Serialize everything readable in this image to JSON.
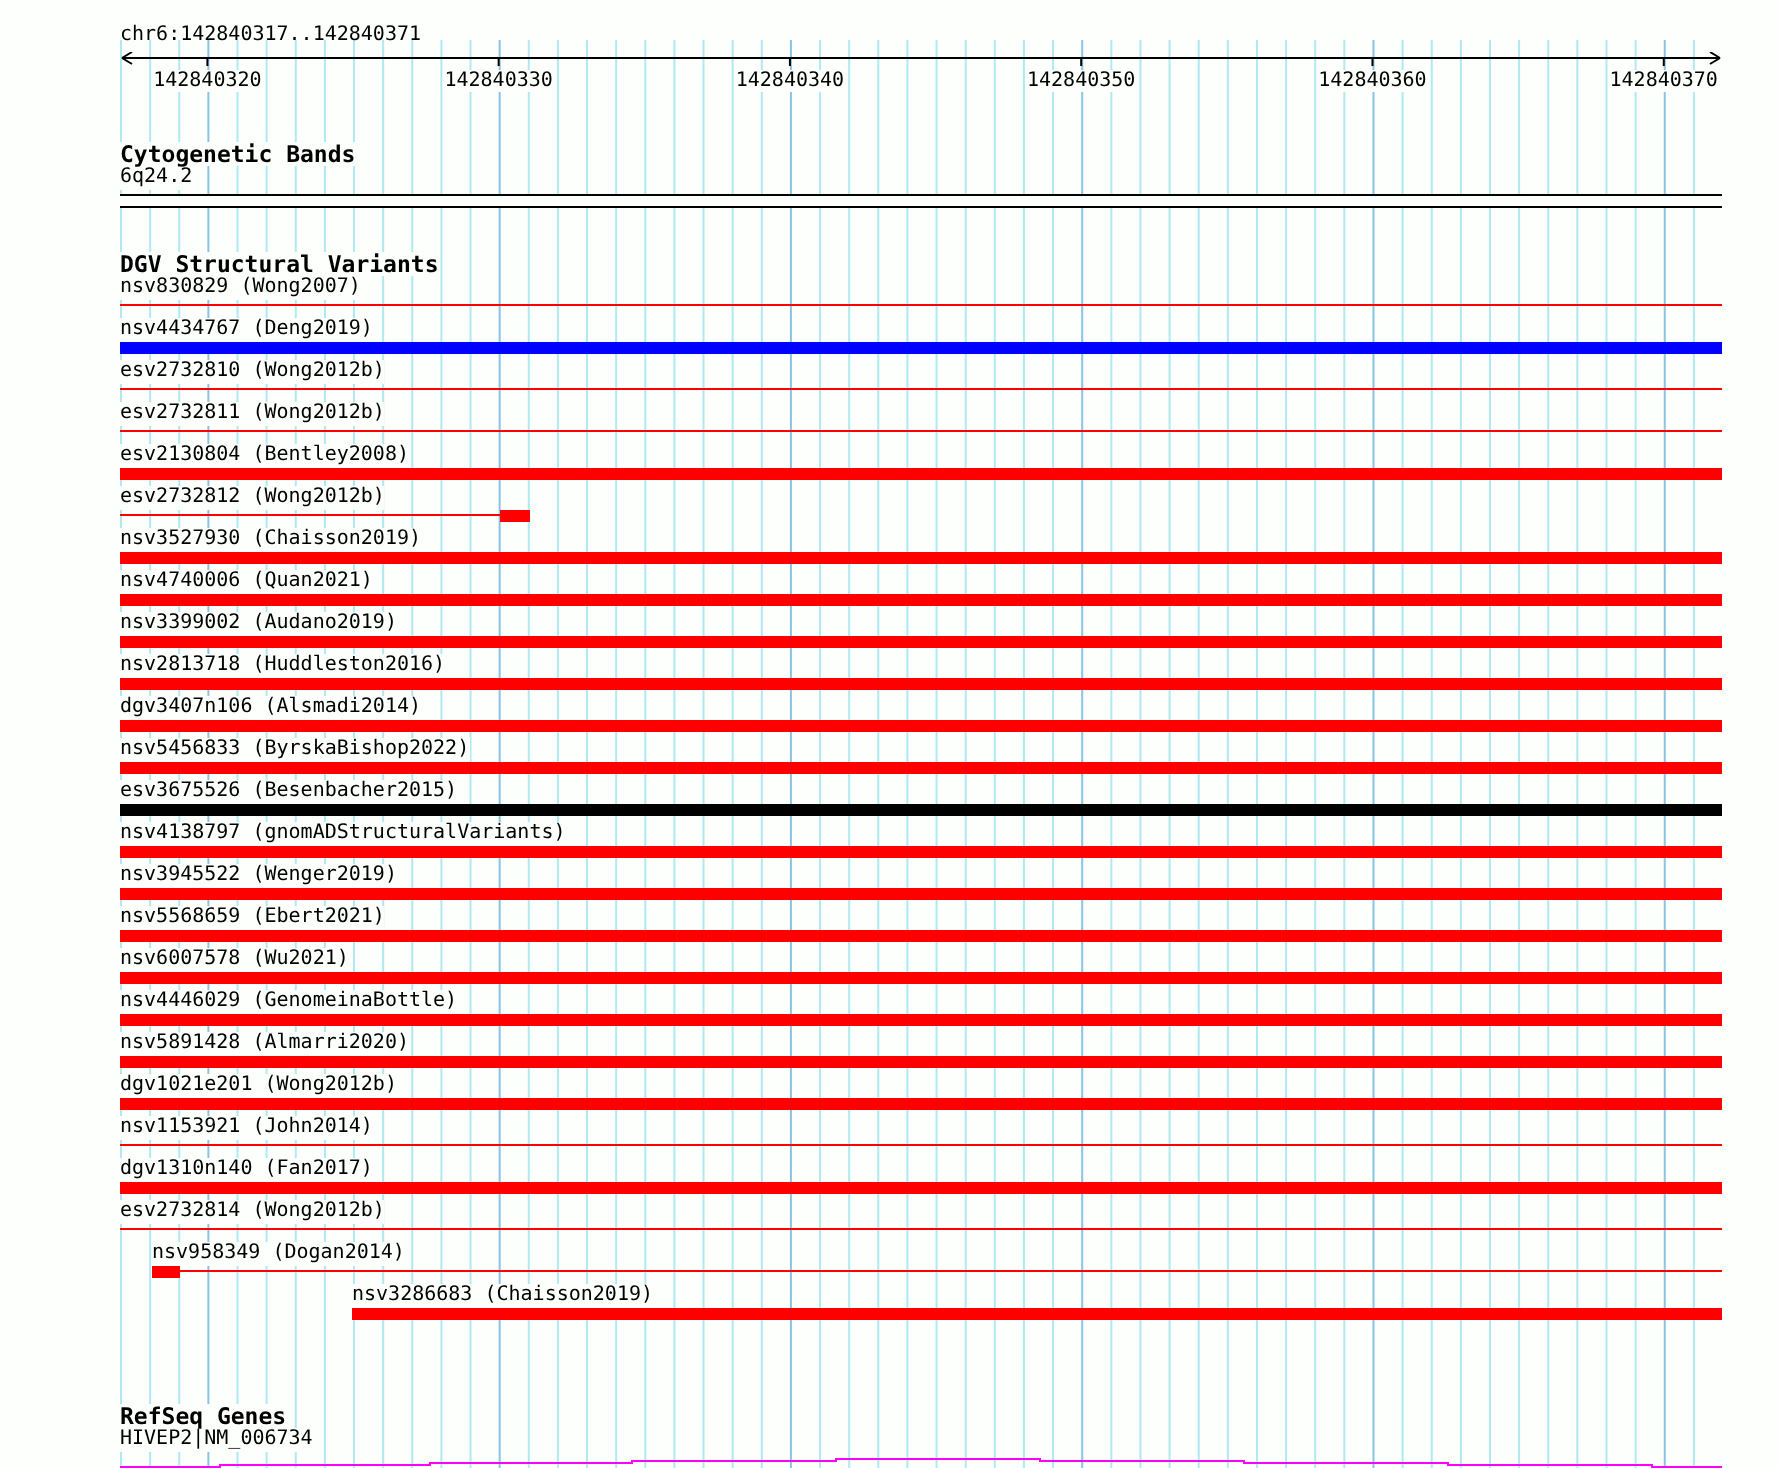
{
  "ruler": {
    "location": "chr6:142840317..142840371",
    "ticks": [
      "142840320",
      "142840330",
      "142840340",
      "142840350",
      "142840360",
      "142840370"
    ]
  },
  "cytogenetic_bands": {
    "title": "Cytogenetic Bands",
    "band": "6q24.2"
  },
  "dgv": {
    "title": "DGV Structural Variants",
    "variants": [
      {
        "label": "nsv830829 (Wong2007)",
        "color": "#ff0000",
        "kind": "thin"
      },
      {
        "label": "nsv4434767 (Deng2019)",
        "color": "#0000ff",
        "kind": "thick"
      },
      {
        "label": "esv2732810 (Wong2012b)",
        "color": "#ff0000",
        "kind": "thin"
      },
      {
        "label": "esv2732811 (Wong2012b)",
        "color": "#ff0000",
        "kind": "thin"
      },
      {
        "label": "esv2130804 (Bentley2008)",
        "color": "#ff0000",
        "kind": "thick"
      },
      {
        "label": "esv2732812 (Wong2012b)",
        "color": "#ff0000",
        "kind": "thinblock"
      },
      {
        "label": "nsv3527930 (Chaisson2019)",
        "color": "#ff0000",
        "kind": "thick"
      },
      {
        "label": "nsv4740006 (Quan2021)",
        "color": "#ff0000",
        "kind": "thick"
      },
      {
        "label": "nsv3399002 (Audano2019)",
        "color": "#ff0000",
        "kind": "thick"
      },
      {
        "label": "nsv2813718 (Huddleston2016)",
        "color": "#ff0000",
        "kind": "thick"
      },
      {
        "label": "dgv3407n106 (Alsmadi2014)",
        "color": "#ff0000",
        "kind": "thick"
      },
      {
        "label": "nsv5456833 (ByrskaBishop2022)",
        "color": "#ff0000",
        "kind": "thick"
      },
      {
        "label": "esv3675526 (Besenbacher2015)",
        "color": "#000000",
        "kind": "thick"
      },
      {
        "label": "nsv4138797 (gnomADStructuralVariants)",
        "color": "#ff0000",
        "kind": "thick"
      },
      {
        "label": "nsv3945522 (Wenger2019)",
        "color": "#ff0000",
        "kind": "thick"
      },
      {
        "label": "nsv5568659 (Ebert2021)",
        "color": "#ff0000",
        "kind": "thick"
      },
      {
        "label": "nsv6007578 (Wu2021)",
        "color": "#ff0000",
        "kind": "thick"
      },
      {
        "label": "nsv4446029 (GenomeinaBottle)",
        "color": "#ff0000",
        "kind": "thick"
      },
      {
        "label": "nsv5891428 (Almarri2020)",
        "color": "#ff0000",
        "kind": "thick"
      },
      {
        "label": "dgv1021e201 (Wong2012b)",
        "color": "#ff0000",
        "kind": "thick"
      },
      {
        "label": "nsv1153921 (John2014)",
        "color": "#ff0000",
        "kind": "thin"
      },
      {
        "label": "dgv1310n140 (Fan2017)",
        "color": "#ff0000",
        "kind": "thick"
      },
      {
        "label": "esv2732814 (Wong2012b)",
        "color": "#ff0000",
        "kind": "thin"
      },
      {
        "label": "nsv958349 (Dogan2014)",
        "color": "#ff0000",
        "kind": "blockthin"
      },
      {
        "label": "nsv3286683 (Chaisson2019)",
        "color": "#ff0000",
        "kind": "offsetthick"
      }
    ]
  },
  "refseq": {
    "title": "RefSeq Genes",
    "gene": "HIVEP2|NM_006734"
  }
}
